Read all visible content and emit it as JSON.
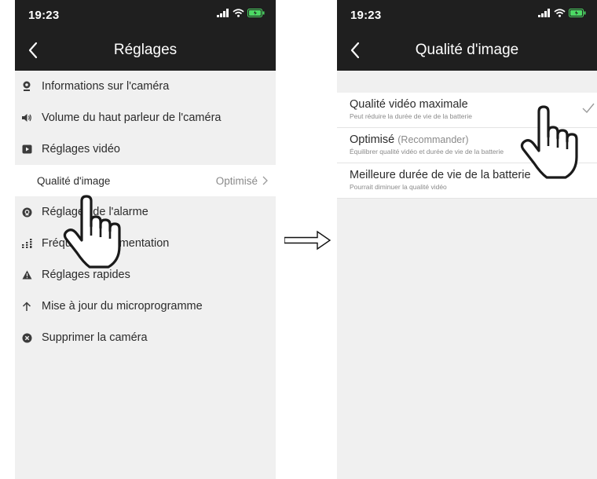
{
  "left_screen": {
    "status": {
      "time": "19:23"
    },
    "nav": {
      "title": "Réglages"
    },
    "items": [
      {
        "label": "Informations sur l'caméra",
        "icon": "camera-info-icon"
      },
      {
        "label": "Volume du haut parleur de l'caméra",
        "icon": "speaker-icon"
      },
      {
        "label": "Réglages vidéo",
        "icon": "video-icon"
      }
    ],
    "sub_item": {
      "label": "Qualité d'image",
      "value": "Optimisé"
    },
    "items_after": [
      {
        "label": "Réglages de l'alarme",
        "icon": "alarm-icon"
      },
      {
        "label": "Fréquence d'alimentation",
        "icon": "frequency-icon"
      },
      {
        "label": "Réglages rapides",
        "icon": "warning-icon"
      },
      {
        "label": "Mise à jour du microprogramme",
        "icon": "arrow-up-icon"
      },
      {
        "label": "Supprimer la caméra",
        "icon": "delete-icon"
      }
    ]
  },
  "right_screen": {
    "status": {
      "time": "19:23"
    },
    "nav": {
      "title": "Qualité d'image"
    },
    "options": [
      {
        "label": "Qualité vidéo maximale",
        "note": "",
        "description": "Peut réduire la durée de vie de la batterie",
        "selected": true
      },
      {
        "label": "Optimisé",
        "note": "(Recommander)",
        "description": "Équilibrer qualité vidéo et durée de vie de la batterie",
        "selected": false
      },
      {
        "label": "Meilleure durée de vie de la batterie",
        "note": "",
        "description": "Pourrait diminuer la qualité vidéo",
        "selected": false
      }
    ]
  },
  "colors": {
    "header": "#1f1f1f",
    "background": "#f0f0f0",
    "text": "#2b2b2b",
    "muted": "#8a8a8a",
    "battery": "#4cd964"
  }
}
